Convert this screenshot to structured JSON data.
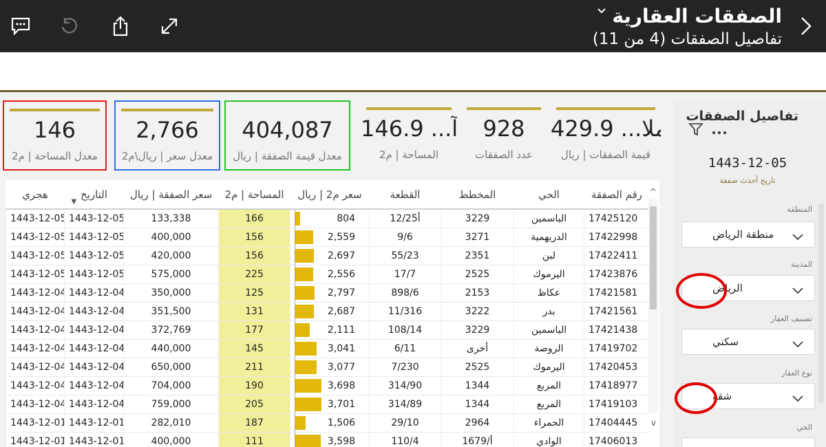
{
  "header": {
    "title": "الصفقات العقارية",
    "subtitle": "تفاصيل الصفقات (4 من 11)"
  },
  "kpis": [
    {
      "value": "146",
      "label": "معدل المساحة | م2",
      "highlight": "#e21a1a"
    },
    {
      "value": "2,766",
      "label": "معدل سعر | ريال\\م2",
      "highlight": "#2a6ee8"
    },
    {
      "value": "404,087",
      "label": "معدل قيمة الصفقة | ريال",
      "highlight": "#22c322"
    },
    {
      "value": "146.9 ...آ",
      "label": "المساحة | م2"
    },
    {
      "value": "928",
      "label": "عدد الصفقات"
    },
    {
      "value": "429.9 ...ملا",
      "label": "قيمة الصفقات | ريال"
    }
  ],
  "table": {
    "headers": [
      "هجري",
      "التاريخ",
      "سعر الصفقة | ريال",
      "المساحة | م2",
      "سعر م2 | ريال",
      "القطعة",
      "المخطط",
      "الحي",
      "رقم الصفقة"
    ],
    "rows": [
      [
        "1443-12-05",
        "1443-12-05",
        "133,338",
        "166",
        "804",
        "12/25أ",
        "3229",
        "الياسمين",
        "17425120"
      ],
      [
        "1443-12-05",
        "1443-12-05",
        "400,000",
        "156",
        "2,559",
        "9/6",
        "3271",
        "الدريهمية",
        "17422998"
      ],
      [
        "1443-12-05",
        "1443-12-05",
        "420,000",
        "156",
        "2,697",
        "55/23",
        "2351",
        "لبن",
        "17422411"
      ],
      [
        "1443-12-05",
        "1443-12-05",
        "575,000",
        "225",
        "2,556",
        "17/7",
        "2525",
        "اليرموك",
        "17423876"
      ],
      [
        "1443-12-04",
        "1443-12-04",
        "350,000",
        "125",
        "2,797",
        "898/6",
        "2153",
        "عكاظ",
        "17421581"
      ],
      [
        "1443-12-04",
        "1443-12-04",
        "351,500",
        "131",
        "2,687",
        "11/316",
        "3222",
        "بدر",
        "17421561"
      ],
      [
        "1443-12-04",
        "1443-12-04",
        "372,769",
        "177",
        "2,111",
        "108/14",
        "3229",
        "الياسمين",
        "17421438"
      ],
      [
        "1443-12-04",
        "1443-12-04",
        "440,000",
        "145",
        "3,041",
        "6/11",
        "أخرى",
        "الروضة",
        "17419702"
      ],
      [
        "1443-12-04",
        "1443-12-04",
        "650,000",
        "211",
        "3,077",
        "7/230",
        "2525",
        "اليرموك",
        "17420453"
      ],
      [
        "1443-12-04",
        "1443-12-04",
        "704,000",
        "190",
        "3,698",
        "314/90",
        "1344",
        "المربع",
        "17418977"
      ],
      [
        "1443-12-04",
        "1443-12-04",
        "759,000",
        "205",
        "3,701",
        "314/89",
        "1344",
        "المربع",
        "17419103"
      ],
      [
        "1443-12-01",
        "1443-12-01",
        "282,010",
        "187",
        "1,506",
        "29/10",
        "2964",
        "الحمراء",
        "17404445"
      ],
      [
        "1443-12-01",
        "1443-12-01",
        "400,000",
        "111",
        "3,598",
        "110/4",
        "1679/أ",
        "الوادي",
        "17406013"
      ]
    ],
    "price_sqm_values": [
      804,
      2559,
      2697,
      2556,
      2797,
      2687,
      2111,
      3041,
      3077,
      3698,
      3701,
      1506,
      3598
    ]
  },
  "panel": {
    "title": "تفاصيل الصفقات",
    "latest_date": "1443-12-05",
    "latest_date_label": "تاريخ أحدث صفقة",
    "filters": [
      {
        "label": "المنطقة",
        "value": "منطقة الرياض"
      },
      {
        "label": "المدينة",
        "value": "الرياض"
      },
      {
        "label": "تصنيف العقار",
        "value": "سكني"
      },
      {
        "label": "نوع العقار",
        "value": "شقة"
      },
      {
        "label": "الحي",
        "value": ""
      }
    ]
  },
  "colors": {
    "header_bg": "#252423",
    "accent_gold": "#c2a83a",
    "area_fill": "#f0f09a",
    "price_bar": "#e2b90b",
    "annotation_red": "#e10000"
  }
}
